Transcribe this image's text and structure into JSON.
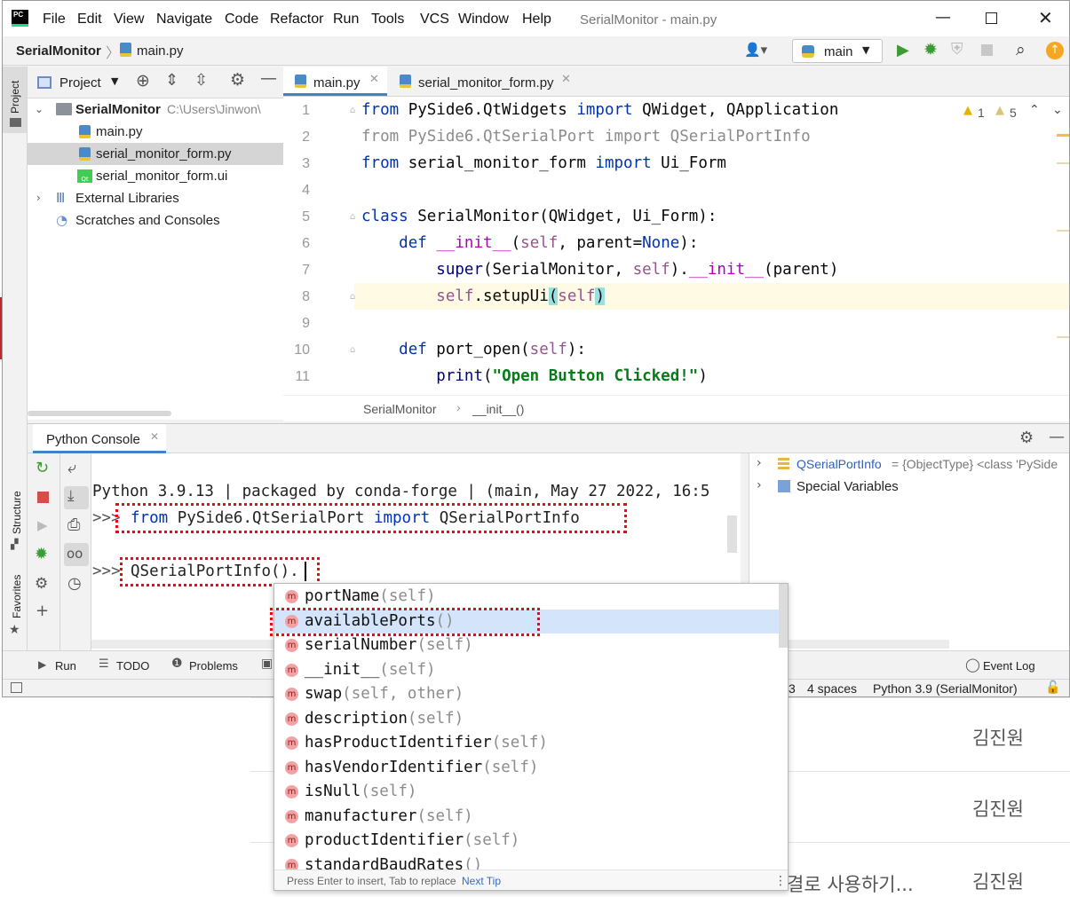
{
  "window": {
    "title": "SerialMonitor - main.py",
    "logo": "PC"
  },
  "menu": [
    "File",
    "Edit",
    "View",
    "Navigate",
    "Code",
    "Refactor",
    "Run",
    "Tools",
    "VCS",
    "Window",
    "Help"
  ],
  "navbar": {
    "project": "SerialMonitor",
    "file": "main.py",
    "run_config": "main"
  },
  "project_panel": {
    "title": "Project",
    "root": {
      "name": "SerialMonitor",
      "path": "C:\\Users\\Jinwon\\"
    },
    "files": [
      "main.py",
      "serial_monitor_form.py",
      "serial_monitor_form.ui"
    ],
    "external": "External Libraries",
    "scratches": "Scratches and Consoles"
  },
  "left_stripe": {
    "project": "Project",
    "structure": "Structure",
    "favorites": "Favorites"
  },
  "editor": {
    "tabs": [
      "main.py",
      "serial_monitor_form.py"
    ],
    "inspections": {
      "warnings": "1",
      "weak_warnings": "5"
    },
    "line_numbers": [
      "1",
      "2",
      "3",
      "4",
      "5",
      "6",
      "7",
      "8",
      "9",
      "10",
      "11"
    ],
    "breadcrumb": [
      "SerialMonitor",
      "__init__()"
    ]
  },
  "console": {
    "tab": "Python Console",
    "banner": "Python 3.9.13 | packaged by conda-forge | (main, May 27 2022, 16:5",
    "prompt": ">>>",
    "line1": "from PySide6.QtSerialPort import QSerialPortInfo",
    "line2": "QSerialPortInfo()."
  },
  "variables": {
    "item1_name": "QSerialPortInfo",
    "item1_value": " = {ObjectType} <class 'PySide",
    "item2_name": "Special Variables"
  },
  "completion": {
    "items": [
      {
        "name": "portName",
        "params": "(self)"
      },
      {
        "name": "availablePorts",
        "params": "()"
      },
      {
        "name": "serialNumber",
        "params": "(self)"
      },
      {
        "name": "__init__",
        "params": "(self)"
      },
      {
        "name": "swap",
        "params": "(self, other)"
      },
      {
        "name": "description",
        "params": "(self)"
      },
      {
        "name": "hasProductIdentifier",
        "params": "(self)"
      },
      {
        "name": "hasVendorIdentifier",
        "params": "(self)"
      },
      {
        "name": "isNull",
        "params": "(self)"
      },
      {
        "name": "manufacturer",
        "params": "(self)"
      },
      {
        "name": "productIdentifier",
        "params": "(self)"
      },
      {
        "name": "standardBaudRates",
        "params": "()"
      }
    ],
    "badge": "m",
    "footer": "Press Enter to insert, Tab to replace",
    "next_tip": "Next Tip"
  },
  "bottom_tabs": [
    "Run",
    "TODO",
    "Problems",
    "Event Log"
  ],
  "status": {
    "pos": "3",
    "indent": "4 spaces",
    "interpreter": "Python 3.9 (SerialMonitor)"
  },
  "background_page": {
    "author": "김진원",
    "snippet": "결로 사용하기..."
  },
  "colors": {
    "keyword": "#0033b3",
    "self": "#94558d",
    "string": "#067d17",
    "selection": "#d4e4fa",
    "highlight_line": "#fffae3"
  }
}
